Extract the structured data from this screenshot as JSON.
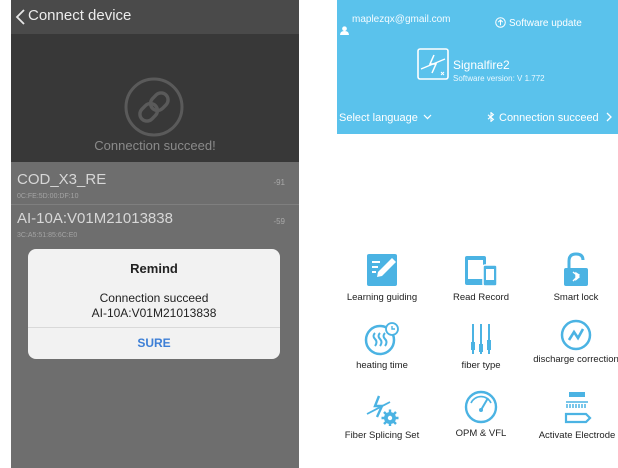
{
  "left_screen": {
    "header_title": "Connect device",
    "connection_message": "Connection succeed!",
    "devices": [
      {
        "name": "COD_X3_RE",
        "mac": "0C:FE:5D:00:DF:10",
        "rssi": "-91"
      },
      {
        "name": "AI-10A:V01M21013838",
        "mac": "3C:A5:51:85:6C:E0",
        "rssi": "-59"
      }
    ],
    "dialog": {
      "title": "Remind",
      "line1": "Connection succeed",
      "line2": "AI-10A:V01M21013838",
      "button": "SURE"
    }
  },
  "right_screen": {
    "account_email": "maplezqx@gmail.com",
    "software_update": "Software update",
    "device_name": "Signalfire2",
    "software_version": "Software version: V 1.772",
    "select_language": "Select language",
    "connection_status": "Connection succeed",
    "menu": [
      {
        "label": "Learning guiding",
        "icon": "learning-guide-icon"
      },
      {
        "label": "Read Record",
        "icon": "read-record-icon"
      },
      {
        "label": "Smart lock",
        "icon": "smart-lock-icon"
      },
      {
        "label": "heating time",
        "icon": "heating-time-icon"
      },
      {
        "label": "fiber type",
        "icon": "fiber-type-icon"
      },
      {
        "label": "discharge correction",
        "icon": "discharge-correction-icon"
      },
      {
        "label": "Fiber Splicing Set",
        "icon": "fiber-splicing-set-icon"
      },
      {
        "label": "OPM & VFL",
        "icon": "opm-vfl-icon"
      },
      {
        "label": "Activate Electrode",
        "icon": "activate-electrode-icon"
      }
    ]
  },
  "colors": {
    "accent_blue": "#5ac2ec",
    "dialog_button_blue": "#3d7fd6",
    "dark_header": "#4a4a4a",
    "overlay_gray": "#6e6e6e"
  }
}
